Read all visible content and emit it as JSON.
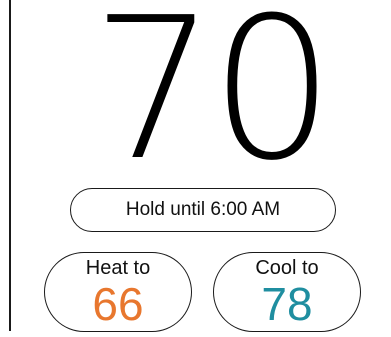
{
  "current_temperature": "70",
  "hold": {
    "label": "Hold until 6:00 AM"
  },
  "heat": {
    "label": "Heat to",
    "value": "66",
    "color": "#e8772e"
  },
  "cool": {
    "label": "Cool to",
    "value": "78",
    "color": "#1f8ea0"
  }
}
